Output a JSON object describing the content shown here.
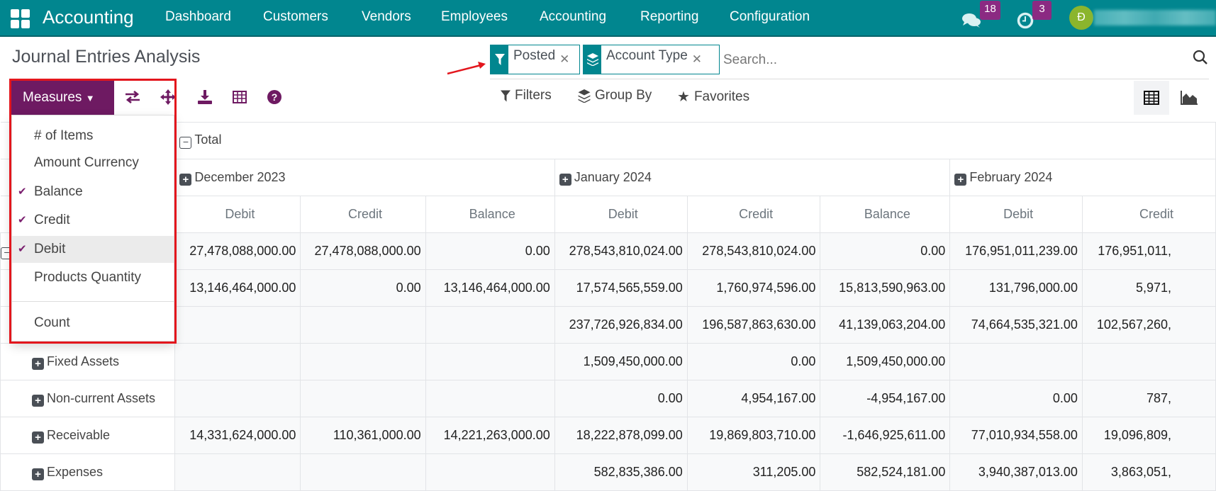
{
  "navbar": {
    "brand": "Accounting",
    "menu": [
      "Dashboard",
      "Customers",
      "Vendors",
      "Employees",
      "Accounting",
      "Reporting",
      "Configuration"
    ],
    "messages_count": "18",
    "activities_count": "3",
    "avatar_initial": "Đ",
    "color": "#01868f"
  },
  "page": {
    "title": "Journal Entries Analysis"
  },
  "search": {
    "facets": [
      {
        "icon": "filter-icon",
        "label": "Posted"
      },
      {
        "icon": "layers-icon",
        "label": "Account Type"
      }
    ],
    "placeholder": "Search...",
    "filters_label": "Filters",
    "groupby_label": "Group By",
    "favorites_label": "Favorites"
  },
  "toolbar": {
    "measures_label": "Measures",
    "accent": "#6e1a62",
    "icons": [
      "flip-axis-icon",
      "expand-all-icon",
      "download-icon",
      "insert-spreadsheet-icon",
      "help-icon"
    ]
  },
  "measures_menu": {
    "items": [
      {
        "label": "# of Items",
        "checked": false
      },
      {
        "label": "Amount Currency",
        "checked": false
      },
      {
        "label": "Balance",
        "checked": true
      },
      {
        "label": "Credit",
        "checked": true
      },
      {
        "label": "Debit",
        "checked": true,
        "hovered": true
      },
      {
        "label": "Products Quantity",
        "checked": false
      }
    ],
    "count_label": "Count"
  },
  "pivot": {
    "total_label": "Total",
    "months": [
      "December 2023",
      "January 2024",
      "February 2024"
    ],
    "measures": [
      "Debit",
      "Credit",
      "Balance",
      "Debit",
      "Credit",
      "Balance",
      "Debit",
      "Credit"
    ],
    "rows": [
      {
        "label": "",
        "values": [
          "27,478,088,000.00",
          "27,478,088,000.00",
          "0.00",
          "278,543,810,024.00",
          "278,543,810,024.00",
          "0.00",
          "176,951,011,239.00",
          "176,951,011,"
        ]
      },
      {
        "label": "",
        "values": [
          "13,146,464,000.00",
          "0.00",
          "13,146,464,000.00",
          "17,574,565,559.00",
          "1,760,974,596.00",
          "15,813,590,963.00",
          "131,796,000.00",
          "5,971,"
        ]
      },
      {
        "label": "",
        "values": [
          "",
          "",
          "",
          "237,726,926,834.00",
          "196,587,863,630.00",
          "41,139,063,204.00",
          "74,664,535,321.00",
          "102,567,260,"
        ]
      },
      {
        "label": "Fixed Assets",
        "values": [
          "",
          "",
          "",
          "1,509,450,000.00",
          "0.00",
          "1,509,450,000.00",
          "",
          ""
        ]
      },
      {
        "label": "Non-current Assets",
        "values": [
          "",
          "",
          "",
          "0.00",
          "4,954,167.00",
          "-4,954,167.00",
          "0.00",
          "787,"
        ]
      },
      {
        "label": "Receivable",
        "values": [
          "14,331,624,000.00",
          "110,361,000.00",
          "14,221,263,000.00",
          "18,222,878,099.00",
          "19,869,803,710.00",
          "-1,646,925,611.00",
          "77,010,934,558.00",
          "19,096,809,"
        ]
      },
      {
        "label": "Expenses",
        "values": [
          "",
          "",
          "",
          "582,835,386.00",
          "311,205.00",
          "582,524,181.00",
          "3,940,387,013.00",
          "3,863,051,"
        ]
      }
    ]
  }
}
